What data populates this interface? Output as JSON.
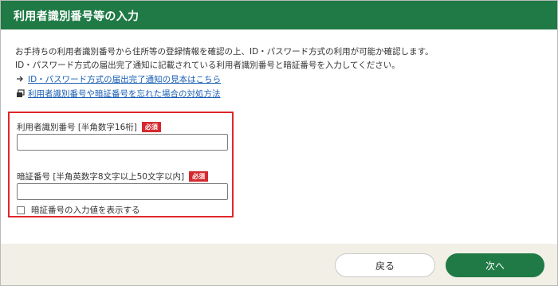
{
  "header": {
    "title": "利用者識別番号等の入力"
  },
  "description": {
    "line1": "お手持ちの利用者識別番号から住所等の登録情報を確認の上、ID・パスワード方式の利用が可能か確認します。",
    "line2": "ID・パスワード方式の届出完了通知に記載されている利用者識別番号と暗証番号を入力してください。"
  },
  "links": [
    {
      "label": "ID・パスワード方式の届出完了通知の見本はこちら",
      "icon": "arrow-right-icon"
    },
    {
      "label": "利用者識別番号や暗証番号を忘れた場合の対処方法",
      "icon": "external-window-icon"
    }
  ],
  "form": {
    "user_id": {
      "label": "利用者識別番号 [半角数字16桁]",
      "required_badge": "必須",
      "value": ""
    },
    "pin": {
      "label": "暗証番号 [半角英数字8文字以上50文字以内]",
      "required_badge": "必須",
      "value": ""
    },
    "show_pin": {
      "label": "暗証番号の入力値を表示する",
      "checked": false
    }
  },
  "footer": {
    "back_label": "戻る",
    "next_label": "次へ"
  },
  "colors": {
    "header": "#1f7a45",
    "primary_button": "#1f7a45",
    "required_badge": "#d5292f",
    "highlight_border": "#e0262c",
    "link": "#1a5fb4",
    "footer_bg": "#f1efe6"
  }
}
